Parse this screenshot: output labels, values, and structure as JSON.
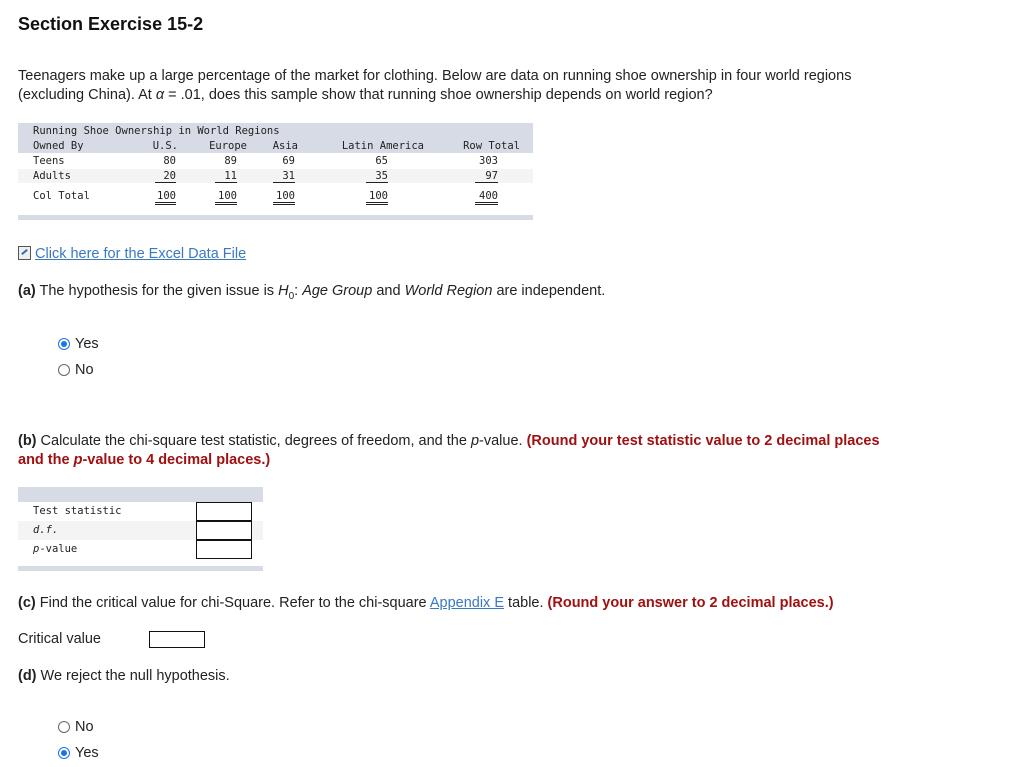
{
  "title": "Section Exercise 15-2",
  "intro_line1": "Teenagers make up a large percentage of the market for clothing. Below are data on running shoe ownership in four world regions",
  "intro_line2_pre": "(excluding China). At ",
  "alpha_symbol": "α",
  "intro_line2_post": " = .01, does this sample show that running shoe ownership depends on world region?",
  "table": {
    "caption": "Running Shoe Ownership in World Regions",
    "headers": [
      "Owned By",
      "U.S.",
      "Europe",
      "Asia",
      "Latin America",
      "Row Total"
    ],
    "rows": [
      {
        "label": "Teens",
        "values": [
          "80",
          "89",
          "69",
          "65",
          "303"
        ]
      },
      {
        "label": "Adults",
        "values": [
          "20",
          "11",
          "31",
          "35",
          "97"
        ]
      },
      {
        "label": "Col Total",
        "values": [
          "100",
          "100",
          "100",
          "100",
          "400"
        ]
      }
    ]
  },
  "excel_link": "Click here for the Excel Data File",
  "part_a": {
    "label": "(a)",
    "text_pre": " The hypothesis for the given issue is ",
    "h": "H",
    "sub": "0",
    "text_colon": ": ",
    "var1": "Age Group",
    "and": " and ",
    "var2": "World Region",
    "text_post": " are independent.",
    "options": [
      {
        "label": "Yes",
        "selected": true
      },
      {
        "label": "No",
        "selected": false
      }
    ]
  },
  "part_b": {
    "label": "(b)",
    "text1": " Calculate the chi-square test statistic, degrees of freedom, and the ",
    "p": "p",
    "text2": "-value. ",
    "red1": "(Round your test statistic value to 2 decimal places",
    "red2a": "and the ",
    "red_p": "p",
    "red2b": "-value to 4 decimal places.)",
    "rows": [
      {
        "label": "Test statistic",
        "value": ""
      },
      {
        "label": "d.f.",
        "value": ""
      },
      {
        "label": "-value",
        "prefix": "p",
        "value": ""
      }
    ]
  },
  "part_c": {
    "label": "(c)",
    "text1": " Find the critical value for chi-Square. Refer to the chi-square ",
    "link": "Appendix E",
    "text2": " table. ",
    "red": "(Round your answer to 2 decimal places.)",
    "field_label": "Critical value",
    "value": ""
  },
  "part_d": {
    "label": "(d)",
    "text": " We reject the null hypothesis.",
    "options": [
      {
        "label": "No",
        "selected": false
      },
      {
        "label": "Yes",
        "selected": true
      }
    ]
  },
  "colors": {
    "accent": "#1a73e8",
    "link": "#3a78c2",
    "instruction_red": "#a01010",
    "table_band": "#d7dbe5"
  }
}
